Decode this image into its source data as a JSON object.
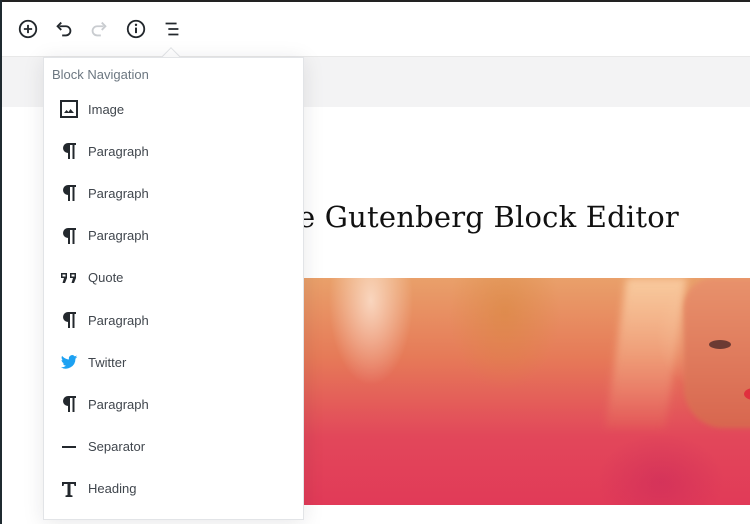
{
  "toolbar": {
    "buttons": [
      {
        "name": "add-block",
        "icon": "plus-circle-icon",
        "enabled": true
      },
      {
        "name": "undo",
        "icon": "undo-icon",
        "enabled": true
      },
      {
        "name": "redo",
        "icon": "redo-icon",
        "enabled": false
      },
      {
        "name": "content-info",
        "icon": "info-icon",
        "enabled": true
      },
      {
        "name": "block-navigation",
        "icon": "list-icon",
        "enabled": true
      }
    ]
  },
  "post": {
    "title_visible": "e Gutenberg Block Editor"
  },
  "block_navigation": {
    "title": "Block Navigation",
    "items": [
      {
        "label": "Image",
        "icon": "image-icon"
      },
      {
        "label": "Paragraph",
        "icon": "paragraph-icon"
      },
      {
        "label": "Paragraph",
        "icon": "paragraph-icon"
      },
      {
        "label": "Paragraph",
        "icon": "paragraph-icon"
      },
      {
        "label": "Quote",
        "icon": "quote-icon"
      },
      {
        "label": "Paragraph",
        "icon": "paragraph-icon"
      },
      {
        "label": "Twitter",
        "icon": "twitter-icon"
      },
      {
        "label": "Paragraph",
        "icon": "paragraph-icon"
      },
      {
        "label": "Separator",
        "icon": "separator-icon"
      },
      {
        "label": "Heading",
        "icon": "heading-icon"
      }
    ]
  },
  "colors": {
    "icon": "#23282d",
    "icon_disabled": "#c9ccd0",
    "twitter": "#1da1f2",
    "popover_title": "#6c7781"
  }
}
